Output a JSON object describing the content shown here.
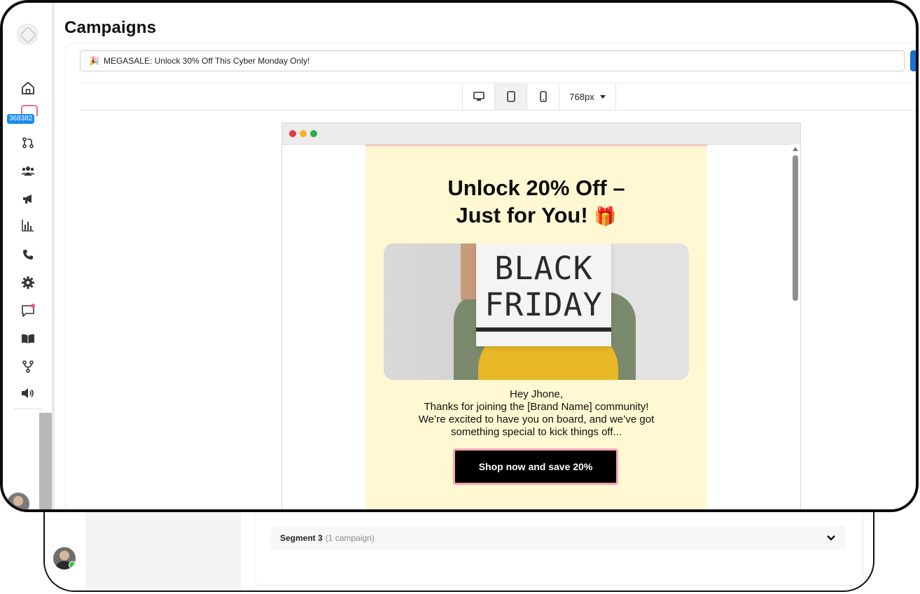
{
  "page": {
    "title": "Campaigns"
  },
  "sidebar": {
    "store_badge": "368382",
    "icons": [
      "home-icon",
      "store-icon",
      "git-pull-request-icon",
      "users-icon",
      "megaphone-icon",
      "bar-chart-icon",
      "phone-icon",
      "gear-icon",
      "chat-icon",
      "book-icon",
      "flow-icon",
      "speaker-icon"
    ]
  },
  "editor": {
    "subject_emoji": "🎉",
    "subject_value": "MEGASALE: Unlock 30% Off This Cyber Monday Only!",
    "devices": [
      "desktop-icon",
      "tablet-icon",
      "mobile-icon"
    ],
    "active_device": "tablet",
    "width_value": "768px"
  },
  "email": {
    "title_line1": "Unlock 20% Off –",
    "title_line2": "Just for You!",
    "title_emoji": "🎁",
    "hero_text": "BLACK FRIDAY",
    "body_lines": [
      "Hey Jhone,",
      "Thanks for joining the [Brand Name] community!",
      "We’re excited to have you on board, and we’ve got",
      "something special to kick things off..."
    ],
    "cta_label": "Shop now and save 20%"
  },
  "segments": [
    {
      "name": "Segment 3",
      "count": "(1 campaign)"
    }
  ],
  "colors": {
    "email_bg": "#fff8d2",
    "cta_bg": "#000000",
    "cta_border": "#f4a4b4",
    "accent_blue": "#1a6fd8"
  }
}
